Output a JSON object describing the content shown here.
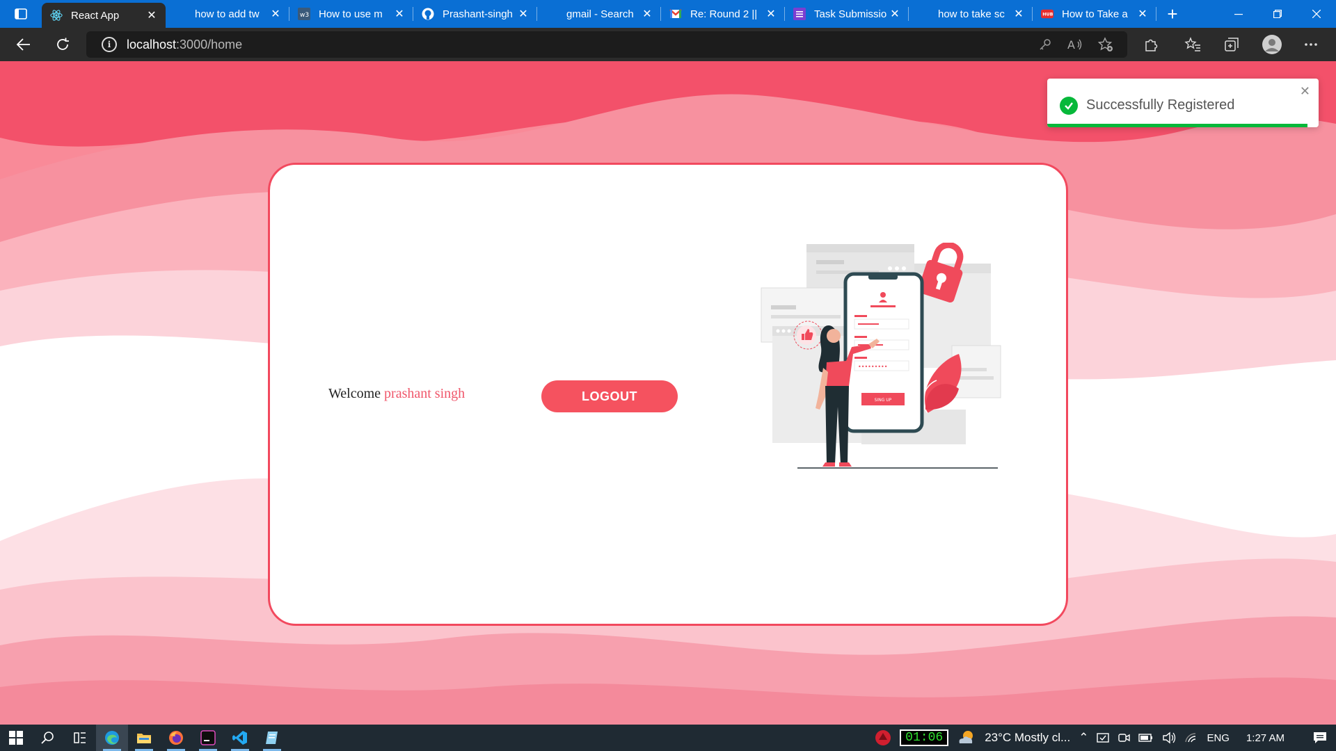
{
  "browser": {
    "tabs": [
      {
        "title": "React App",
        "icon": "react-icon",
        "active": true
      },
      {
        "title": "how to add tw",
        "icon": "blank-icon"
      },
      {
        "title": "How to use m",
        "icon": "w3-icon"
      },
      {
        "title": "Prashant-singh",
        "icon": "github-icon"
      },
      {
        "title": "gmail - Search",
        "icon": "blank-icon"
      },
      {
        "title": "Re: Round 2 ||",
        "icon": "gmail-icon"
      },
      {
        "title": "Task Submissio",
        "icon": "forms-icon"
      },
      {
        "title": "how to take sc",
        "icon": "blank-icon"
      },
      {
        "title": "How to Take a",
        "icon": "hub-icon"
      }
    ],
    "url_host": "localhost",
    "url_path": ":3000/home"
  },
  "page": {
    "welcome_label": "Welcome",
    "user_name": "prashant singh",
    "logout_label": "LOGOUT",
    "illustration": {
      "signup_button_label": "SING UP",
      "password_dots": "•••••••••"
    }
  },
  "toast": {
    "message": "Successfully Registered",
    "close_symbol": "✕",
    "progress_fraction": 0.96,
    "color": "#07b83a"
  },
  "taskbar": {
    "timer": "01:06",
    "weather": "23°C  Mostly cl...",
    "language": "ENG",
    "time": "1:27 AM"
  },
  "colors": {
    "accent": "#f5525f",
    "wave_dark": "#f5536a",
    "wave_light": "#fbc9d1"
  }
}
